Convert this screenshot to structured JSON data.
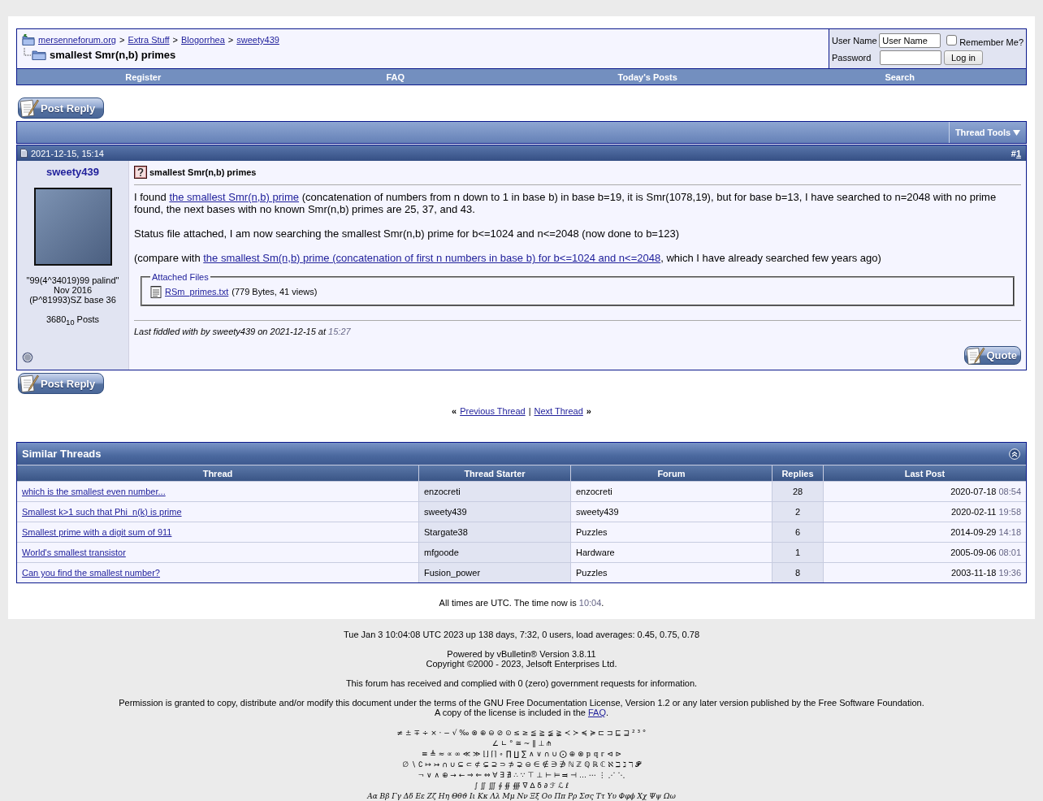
{
  "header": {
    "breadcrumb": [
      {
        "label": "mersenneforum.org"
      },
      {
        "separator": ">",
        "label": "Extra Stuff"
      },
      {
        "separator": ">",
        "label": "Blogorrhea"
      },
      {
        "separator": ">",
        "label": "sweety439"
      }
    ],
    "title": "smallest Smr(n,b) primes"
  },
  "login": {
    "username_label": "User Name",
    "username_value": "User Name",
    "remember_label": "Remember Me?",
    "remember_checked": false,
    "password_label": "Password",
    "button": "Log in"
  },
  "navbar": [
    "Register",
    "FAQ",
    "Today's Posts",
    "Search"
  ],
  "top_reply_button": "Post Reply",
  "thread_tools": "Thread Tools",
  "post": {
    "date": "2021-12-15, 15:14",
    "number_prefix": "#",
    "number": "1",
    "username": "sweety439",
    "user_title": "\"99(4^34019)99 palind\"",
    "join_date": "Nov 2016",
    "location": "(P^81993)SZ base 36",
    "posts": "3680$_{10}$ Posts",
    "online": false,
    "title": "smallest Smr(n,b) primes",
    "paragraphs": [
      [
        {
          "kind": "text",
          "text": "I found "
        },
        {
          "kind": "link",
          "text": "the smallest Smr(n,b) prime"
        },
        {
          "kind": "text",
          "text": " (concatenation of numbers from n down to 1 in base b) in base b=19, it is Smr(1078,19), but for base b=13, I have searched to n=2048 with no prime found, the next bases with no known Smr(n,b) primes are 25, 37, and 43."
        }
      ],
      [
        {
          "kind": "text",
          "text": "Status file attached, I am now searching the smallest Smr(n,b) prime for b<=1024 and n<=2048 (now done to b=123)"
        }
      ],
      [
        {
          "kind": "text",
          "text": "(compare with "
        },
        {
          "kind": "link",
          "text": "the smallest Sm(n,b) prime (concatenation of first n numbers in base b) for b<=1024 and n<=2048"
        },
        {
          "kind": "text",
          "text": ", which I have already searched few years ago)"
        }
      ]
    ],
    "attachments_legend": "Attached Files",
    "attachments": [
      {
        "name": "RSm_primes.txt",
        "info": "(779 Bytes, 41 views)"
      }
    ],
    "edit_note": "Last fiddled with by sweety439 on 2021-12-15 at",
    "edit_time": "15:27",
    "quote_button": "Quote"
  },
  "bottom_reply_button": "Post Reply",
  "thread_nav": {
    "open": "«",
    "previous": "Previous Thread",
    "divider": "|",
    "next": "Next Thread",
    "close": "»"
  },
  "similar_threads": {
    "title": "Similar Threads",
    "expanded": true,
    "columns": [
      "Thread",
      "Thread Starter",
      "Forum",
      "Replies",
      "Last Post"
    ],
    "rows": [
      {
        "thread": "which is the smallest even number...",
        "starter": "enzocreti",
        "forum": "enzocreti",
        "replies": "28",
        "date": "2020-07-18",
        "time": "08:54"
      },
      {
        "thread": "Smallest k>1 such that Phi_n(k) is prime",
        "starter": "sweety439",
        "forum": "sweety439",
        "replies": "2",
        "date": "2020-02-11",
        "time": "19:58"
      },
      {
        "thread": "Smallest prime with a digit sum of 911",
        "starter": "Stargate38",
        "forum": "Puzzles",
        "replies": "6",
        "date": "2014-09-29",
        "time": "14:18"
      },
      {
        "thread": "World's smallest transistor",
        "starter": "mfgoode",
        "forum": "Hardware",
        "replies": "1",
        "date": "2005-09-06",
        "time": "08:01"
      },
      {
        "thread": "Can you find the smallest number?",
        "starter": "Fusion_power",
        "forum": "Puzzles",
        "replies": "8",
        "date": "2003-11-18",
        "time": "19:36"
      }
    ]
  },
  "time_note": {
    "text": "All times are UTC. The time now is",
    "time": "10:04",
    "end": "."
  },
  "footer": {
    "server_status": "Tue Jan 3 10:04:08 UTC 2023 up 138 days, 7:32, 0 users, load averages: 0.45, 0.75, 0.78",
    "powered_by": "Powered by vBulletin® Version 3.8.11",
    "copyright": "Copyright ©2000 - 2023, Jelsoft Enterprises Ltd.",
    "government": "This forum has received and complied with 0 (zero) government requests for information.",
    "license": "Permission is granted to copy, distribute and/or modify this document under the terms of the GNU Free Documentation License, Version 1.2 or any later version published by the Free Software Foundation.",
    "license_copy": {
      "text": "A copy of the license is included in the",
      "link": "FAQ",
      "end": "."
    },
    "symbol_rows": [
      "≠ ± ∓ ÷ × · − √ ‰ ⊗ ⊕ ⊖ ⊘ ⊙ ≤ ≥ ≦ ≧ ≨ ≩ ≺ ≻ ≼ ≽ ⊏ ⊐ ⊑ ⊒ ² ³ °",
      "∠ ∟ ° ≅ ~ ‖ ⊥ ⫛",
      "≡ ≜ ≈ ∝ ∞ ≪ ≫ ⌊⌋ ⌈⌉ ∘ ∏ ∐ ∑ ∧ ∨ ∩ ∪ ⨀ ⊕ ⊗ 𝕡 𝕢 𝕣 ⊲ ⊳",
      "∅ ∖ ∁ ↦ ↣ ∩ ∪ ⊆ ⊂ ⊄ ⊊ ⊇ ⊃ ⊅ ⊋ ⊖ ∈ ∉ ∋ ∌ ℕ ℤ ℚ ℝ ℂ ℵ ℶ ℷ ℸ 𝓟",
      "¬ ∨ ∧ ⊕ → ← ⇒ ⇐ ⇔ ∀ ∃ ∄ ∴ ∵ ⊤ ⊥ ⊢ ⊨ ⫤ ⊣ … ⋯ ⋮ ⋰ ⋱",
      "∫ ∬ ∭ ∮ ∯ ∰ ∇ ∆ δ ∂ ℱ ℒ ℓ"
    ],
    "greek_row": "Αα Ββ Γγ Δδ Εε Ζζ Ηη Θθϑ Ιι Κκ Λλ Μμ Νν Ξξ Οο Ππ Ρρ Σσς Ττ Υυ Φφϕ Χχ Ψψ Ωω"
  }
}
